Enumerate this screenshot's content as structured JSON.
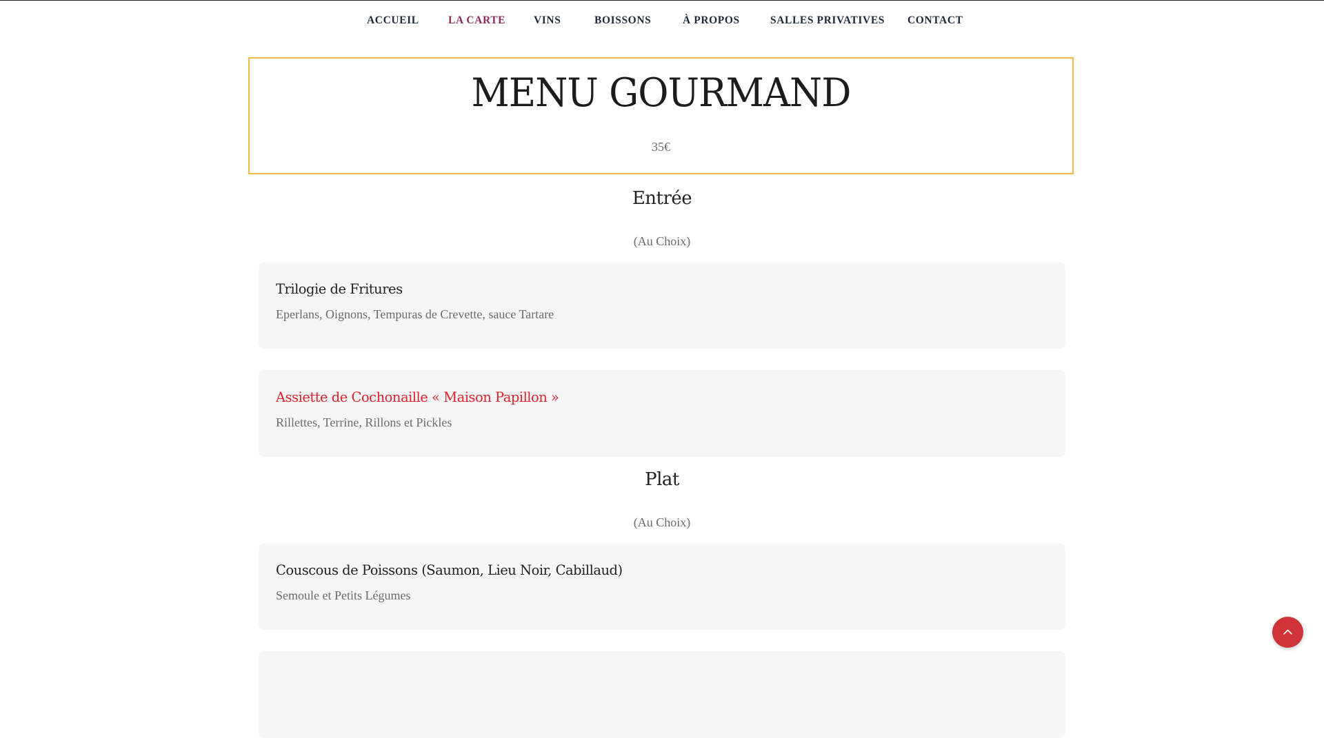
{
  "nav": {
    "items": [
      {
        "label": "ACCUEIL"
      },
      {
        "label": "LA CARTE"
      },
      {
        "label": "VINS"
      },
      {
        "label": "BOISSONS"
      },
      {
        "label": "À PROPOS"
      },
      {
        "label": "SALLES PRIVATIVES"
      },
      {
        "label": "CONTACT"
      }
    ],
    "active_index": 1
  },
  "menu": {
    "title": "MENU GOURMAND",
    "price": "35€"
  },
  "sections": [
    {
      "title": "Entrée",
      "subtitle": "(Au Choix)",
      "dishes": [
        {
          "name": "Trilogie de Fritures",
          "description": "Eperlans, Oignons, Tempuras de Crevette, sauce Tartare"
        },
        {
          "name": "Assiette de Cochonaille « Maison Papillon »",
          "description": "Rillettes, Terrine, Rillons et Pickles"
        }
      ]
    },
    {
      "title": "Plat",
      "subtitle": "(Au Choix)",
      "dishes": [
        {
          "name": "Couscous de Poissons (Saumon, Lieu Noir, Cabillaud)",
          "description": "Semoule et Petits Légumes"
        }
      ]
    }
  ],
  "back_to_top": {
    "icon": "chevron-up-icon"
  },
  "colors": {
    "accent_border": "#f2b84b",
    "nav_active": "#8e2a5a",
    "highlight_dish": "#e0202a",
    "back_to_top": "#d13438",
    "card_bg": "#f6f6f6"
  }
}
